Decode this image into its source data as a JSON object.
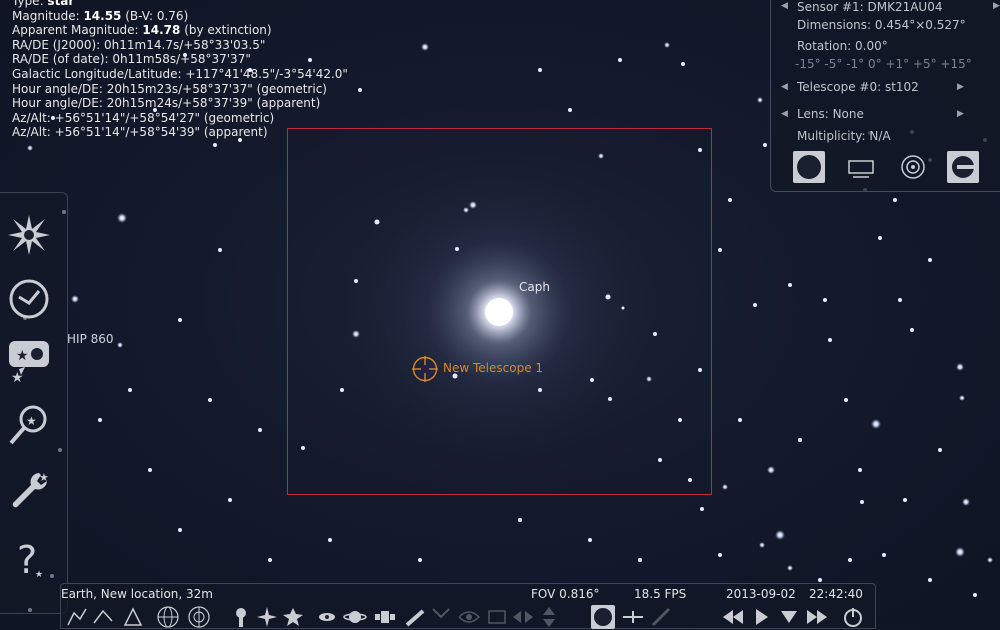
{
  "object_info": [
    {
      "label": "Type: ",
      "value": "star",
      "rest": ""
    },
    {
      "label": "Magnitude: ",
      "value": "14.55",
      "rest": " (B-V: 0.76)"
    },
    {
      "label": "Apparent Magnitude: ",
      "value": "14.78",
      "rest": " (by extinction)"
    },
    {
      "label": "",
      "value": "",
      "rest": "RA/DE (J2000): 0h11m14.7s/+58°33'03.5\""
    },
    {
      "label": "",
      "value": "",
      "rest": "RA/DE (of date): 0h11m58s/+58°37'37\""
    },
    {
      "label": "",
      "value": "",
      "rest": "Galactic Longitude/Latitude: +117°41'48.5\"/-3°54'42.0\""
    },
    {
      "label": "",
      "value": "",
      "rest": "Hour angle/DE: 20h15m23s/+58°37'37\" (geometric)"
    },
    {
      "label": "",
      "value": "",
      "rest": "Hour angle/DE: 20h15m24s/+58°37'39\" (apparent)"
    },
    {
      "label": "",
      "value": "",
      "rest": "Az/Alt: +56°51'14\"/+58°54'27\" (geometric)"
    },
    {
      "label": "",
      "value": "",
      "rest": "Az/Alt: +56°51'14\"/+58°54'39\" (apparent)"
    }
  ],
  "sky_labels": {
    "caph": "Caph",
    "hip": "HIP 860",
    "telescope": "New Telescope 1"
  },
  "ocular_panel": {
    "sensor": "Sensor #1: DMK21AU04",
    "dimensions": "Dimensions: 0.454°×0.527°",
    "rotation": "Rotation: 0.00°",
    "rotation_scale": "-15° -5° -1° 0° +1° +5° +15°",
    "telescope": "Telescope #0: st102",
    "lens": "Lens: None",
    "multiplicity": "Multiplicity: N/A",
    "arrow_left": "◀",
    "arrow_right": "▶"
  },
  "status_bar": {
    "location": "Earth, New location, 32m",
    "fov": "FOV 0.816°",
    "fps": "18.5 FPS",
    "date": "2013-09-02",
    "time": "22:42:40"
  },
  "colors": {
    "ccd_frame": "#c0283c",
    "telescope_reticle": "#d9892a",
    "panel_bg": "#121826"
  },
  "left_toolbar": [
    "starburst-icon",
    "clock-icon",
    "sky-culture-icon",
    "search-icon",
    "wrench-icon",
    "help-icon"
  ],
  "ocular_buttons": [
    "ccd-icon",
    "rectangle-icon",
    "eyepiece-icon",
    "telrad-icon"
  ]
}
